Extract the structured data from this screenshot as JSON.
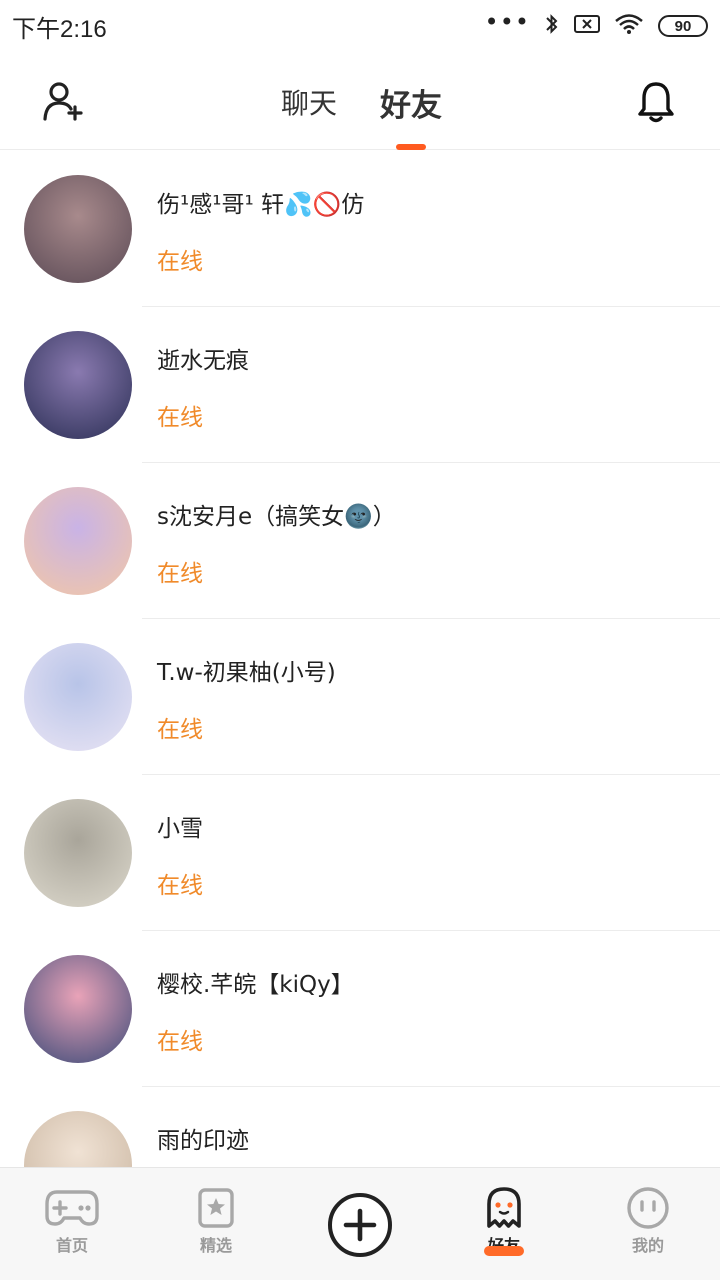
{
  "status_bar": {
    "time": "下午2:16",
    "dots": "•••",
    "battery": "90"
  },
  "header": {
    "tabs": [
      {
        "label": "聊天"
      },
      {
        "label": "好友"
      }
    ],
    "active_tab": "好友"
  },
  "friends": [
    {
      "name": "伤¹感¹哥¹ 轩💦🚫仿",
      "status": "在线",
      "avatar_colors": [
        "#5b4a55",
        "#a88a8c"
      ]
    },
    {
      "name": "逝水无痕",
      "status": "在线",
      "avatar_colors": [
        "#2b2f55",
        "#8a7ab0"
      ]
    },
    {
      "name": "s沈安月e（搞笑女🌚）",
      "status": "在线",
      "avatar_colors": [
        "#f2c7a6",
        "#c9b3e6"
      ]
    },
    {
      "name": "T.w-初果柚(小号)",
      "status": "在线",
      "avatar_colors": [
        "#e9e4f4",
        "#b8c4e8"
      ]
    },
    {
      "name": "小雪",
      "status": "在线",
      "avatar_colors": [
        "#dcd8cc",
        "#a9a59a"
      ]
    },
    {
      "name": "樱校.芊皖【kiQy】",
      "status": "在线",
      "avatar_colors": [
        "#3b4a78",
        "#e9a3b8"
      ]
    },
    {
      "name": "雨的印迹",
      "status": "",
      "avatar_colors": [
        "#c9b5a0",
        "#f0e2d4"
      ]
    }
  ],
  "bottom_nav": {
    "home": "首页",
    "featured": "精选",
    "friends": "好友",
    "me": "我的"
  },
  "colors": {
    "accent": "#ff5a1f",
    "online": "#f08a2a"
  }
}
